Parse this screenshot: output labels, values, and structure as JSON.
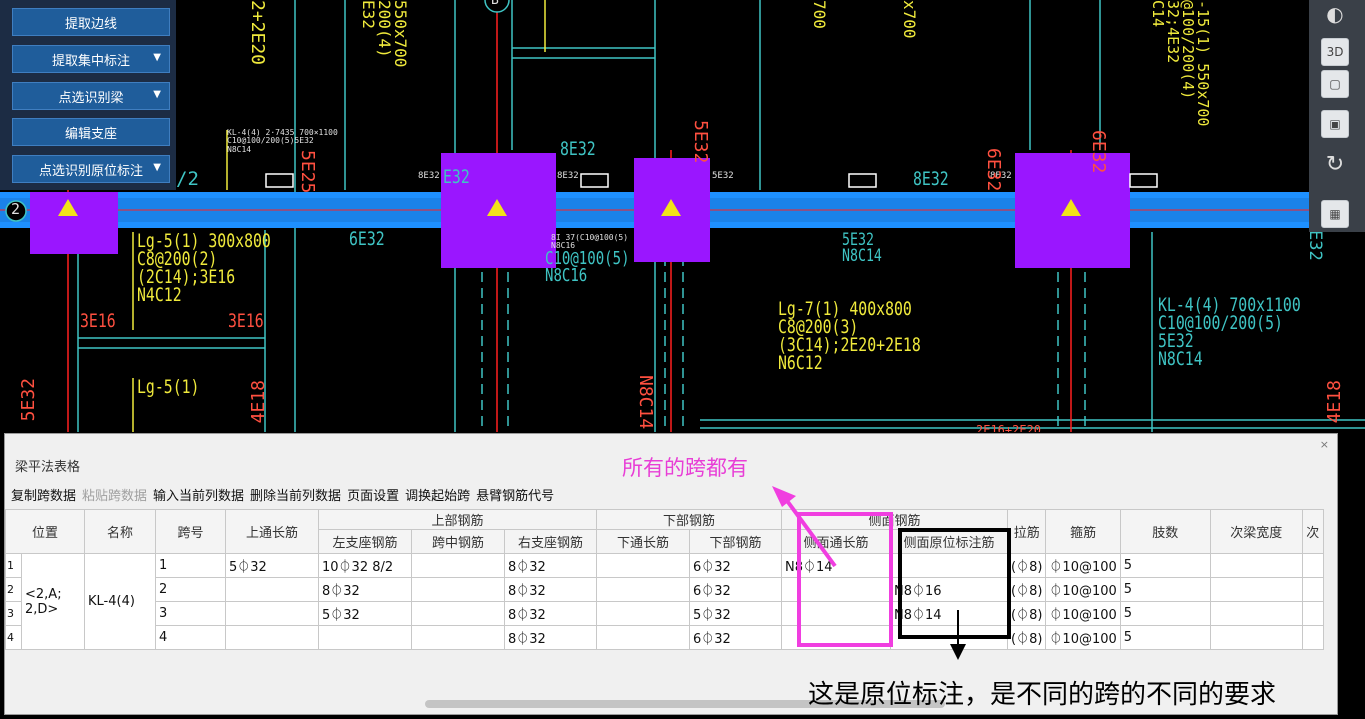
{
  "left_panel": {
    "buttons": [
      {
        "label": "提取边线",
        "has_menu": false
      },
      {
        "label": "提取集中标注",
        "has_menu": true
      },
      {
        "label": "点选识别梁",
        "has_menu": true
      },
      {
        "label": "编辑支座",
        "has_menu": false
      },
      {
        "label": "点选识别原位标注",
        "has_menu": true
      }
    ]
  },
  "cad": {
    "axis_2": "2",
    "axis_B": "B",
    "kl_small_note": "KL-4(4) 2·7435 700×1100\nC10@100/200(5)5E32\nN8C14",
    "lg5_full": "Lg-5(1) 300x800\nC8@200(2)\n(2C14);3E16\nN4C12",
    "lg5_short": "Lg-5(1)",
    "lg7": "Lg-7(1) 400x800\nC8@200(3)\n(3C14);2E20+2E18\nN6C12",
    "kl4": "KL-4(4) 700x1100\nC10@100/200(5)\n5E32\nN8C14",
    "mid_note": "C10@100(5)\nN8C16",
    "mid_small": "8I 37(C10@100(5)\nN8C16",
    "right_small": "5E32\nN8C14",
    "e3e16_left": "3E16",
    "e3e16_right": "3E16",
    "e6e32": "6E32",
    "e8e32_top": "8E32",
    "e8e32_right": "8E32",
    "e8e32_small_a": "8E32",
    "e8e32_small_b": "8E32",
    "e8e32_small_c": "8E32",
    "e5e32_small": "5E32",
    "top_left_vert": "2+2E20",
    "top_vert_a": "550x700\n200(4)\nE32",
    "top_vert_b": "700",
    "top_vert_c": "x700",
    "top_right_vert": "-15(1) 550x700\n@100/200(4)\n32;4E32\nC14",
    "v_5e32_left": "5E32",
    "v_4e18_left": "4E18",
    "v_5e32_mid": "5E32",
    "v_6e32_right": "6E32",
    "v_6e32_far": "6E32",
    "v_n8c14": "N8C14",
    "v_4e18_right": "4E18",
    "v_5e25": "5E25",
    "v_e32_a": "E32",
    "v_e32_b": "E32",
    "bottom_partial": "2E16+2E20"
  },
  "panel": {
    "title": "梁平法表格",
    "close": "×",
    "toolbar": [
      {
        "label": "复制跨数据",
        "enabled": true
      },
      {
        "label": "粘贴跨数据",
        "enabled": false
      },
      {
        "label": "输入当前列数据",
        "enabled": true
      },
      {
        "label": "删除当前列数据",
        "enabled": true
      },
      {
        "label": "页面设置",
        "enabled": true
      },
      {
        "label": "调换起始跨",
        "enabled": true
      },
      {
        "label": "悬臂钢筋代号",
        "enabled": true
      }
    ],
    "headers": {
      "position": "位置",
      "name": "名称",
      "span": "跨号",
      "top_through": "上通长筋",
      "top_rebar": "上部钢筋",
      "left_support": "左支座钢筋",
      "mid_span": "跨中钢筋",
      "right_support": "右支座钢筋",
      "bottom_rebar": "下部钢筋",
      "bottom_through": "下通长筋",
      "bottom": "下部钢筋",
      "side_rebar": "侧面钢筋",
      "side_through": "侧面通长筋",
      "side_in_situ": "侧面原位标注筋",
      "tie": "拉筋",
      "stirrup": "箍筋",
      "legs": "肢数",
      "secondary_width": "次梁宽度",
      "more": "次"
    },
    "position_value": "<2,A;\n2,D>",
    "name_value": "KL-4(4)",
    "rows": [
      {
        "idx": "1",
        "span": "1",
        "top_through": "5⏀32",
        "left": "10⏀32 8/2",
        "mid": "",
        "right": "8⏀32",
        "b_through": "",
        "bottom": "6⏀32",
        "side_through": "N8⏀14",
        "side_in_situ": "",
        "tie": "(⏀8)",
        "stirrup": "⏀10@100",
        "legs": "5"
      },
      {
        "idx": "2",
        "span": "2",
        "top_through": "",
        "left": "8⏀32",
        "mid": "",
        "right": "8⏀32",
        "b_through": "",
        "bottom": "6⏀32",
        "side_through": "",
        "side_in_situ": "N8⏀16",
        "tie": "(⏀8)",
        "stirrup": "⏀10@100",
        "legs": "5"
      },
      {
        "idx": "3",
        "span": "3",
        "top_through": "",
        "left": "5⏀32",
        "mid": "",
        "right": "8⏀32",
        "b_through": "",
        "bottom": "5⏀32",
        "side_through": "",
        "side_in_situ": "N8⏀14",
        "tie": "(⏀8)",
        "stirrup": "⏀10@100",
        "legs": "5"
      },
      {
        "idx": "4",
        "span": "4",
        "top_through": "",
        "left": "",
        "mid": "",
        "right": "8⏀32",
        "b_through": "",
        "bottom": "6⏀32",
        "side_through": "",
        "side_in_situ": "",
        "tie": "(⏀8)",
        "stirrup": "⏀10@100",
        "legs": "5"
      }
    ]
  },
  "annotations": {
    "pink_text": "所有的跨都有",
    "black_text": "这是原位标注，是不同的跨的不同的要求"
  },
  "colors": {
    "beam_blue": "#1e90ff",
    "column_purple": "#9a16ff",
    "cad_yellow": "#f0ea3c",
    "cad_cyan": "#3fc4c4",
    "annotation_pink": "#f03ee0"
  }
}
